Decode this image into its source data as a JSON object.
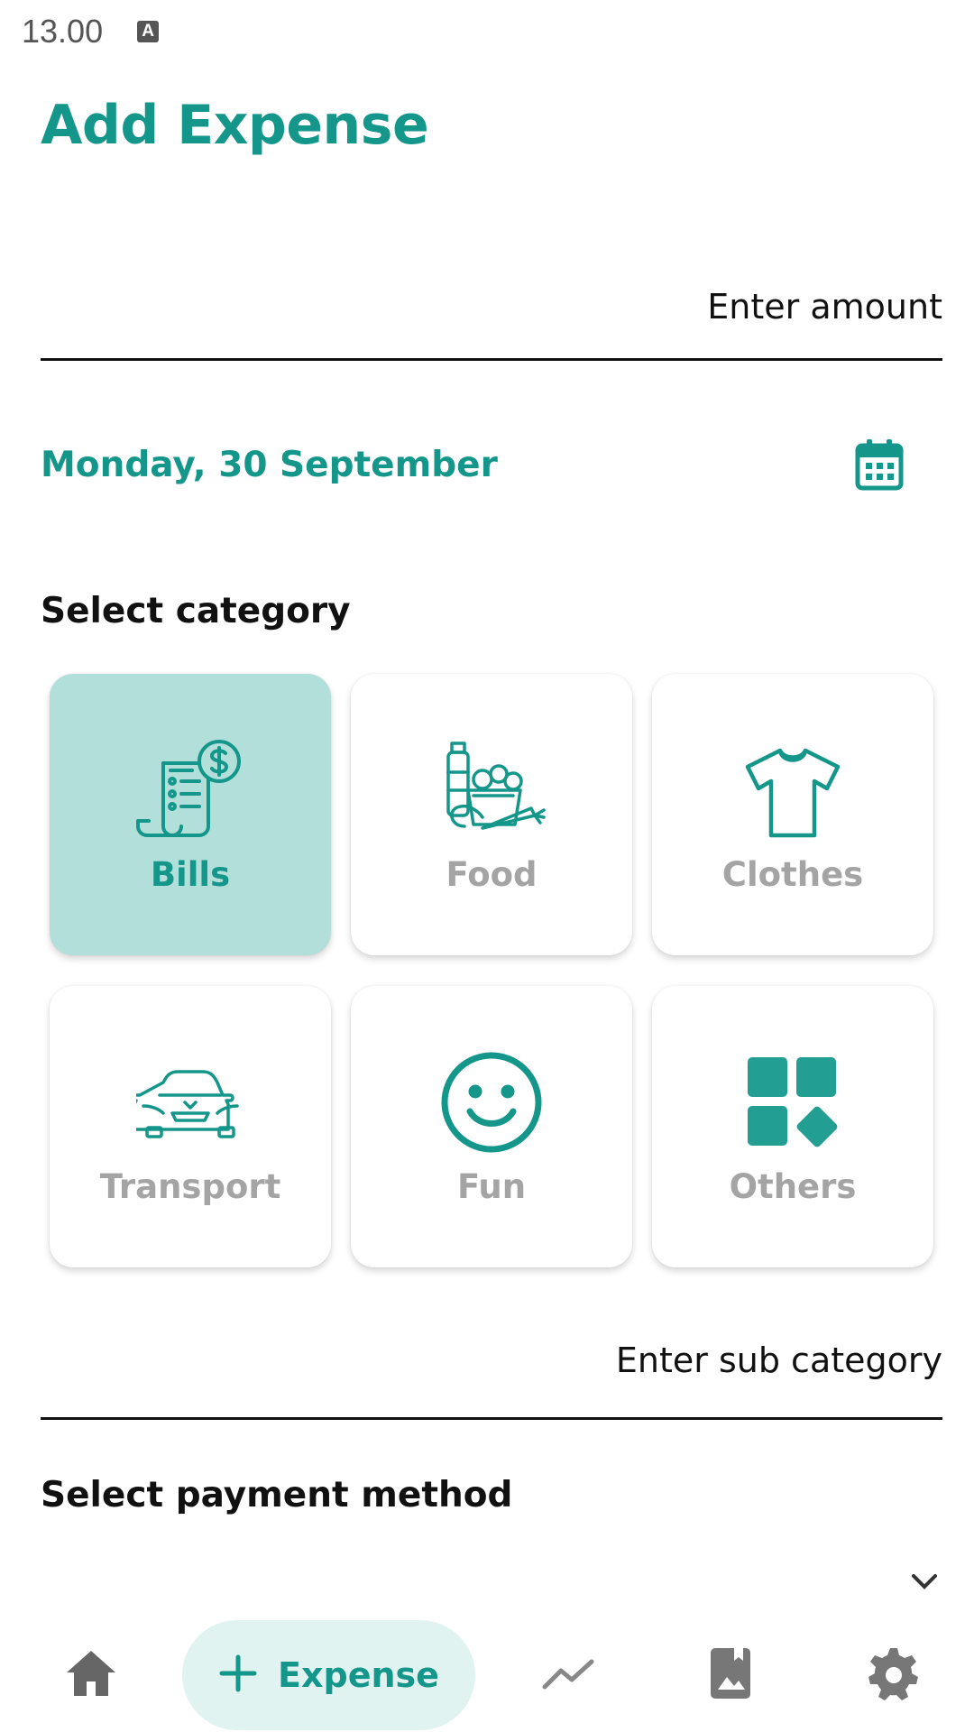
{
  "status_bar": {
    "time": "13.00",
    "indicator": "A"
  },
  "page": {
    "title": "Add Expense"
  },
  "amount": {
    "placeholder": "Enter amount",
    "value": ""
  },
  "date": {
    "label": "Monday, 30 September",
    "icon": "calendar-icon"
  },
  "category": {
    "heading": "Select category",
    "items": [
      {
        "label": "Bills",
        "icon": "bills-receipt-icon",
        "selected": true
      },
      {
        "label": "Food",
        "icon": "groceries-food-icon",
        "selected": false
      },
      {
        "label": "Clothes",
        "icon": "tshirt-icon",
        "selected": false
      },
      {
        "label": "Transport",
        "icon": "car-icon",
        "selected": false
      },
      {
        "label": "Fun",
        "icon": "smiley-face-icon",
        "selected": false
      },
      {
        "label": "Others",
        "icon": "apps-grid-icon",
        "selected": false
      }
    ]
  },
  "sub_category": {
    "placeholder": "Enter sub category",
    "value": ""
  },
  "payment": {
    "heading": "Select payment method",
    "selected_value": ""
  },
  "bottom_nav": {
    "items": [
      {
        "name": "home",
        "icon": "home-icon"
      },
      {
        "name": "expense",
        "label": "Expense",
        "icon": "plus-icon",
        "active": true
      },
      {
        "name": "stats",
        "icon": "trending-icon"
      },
      {
        "name": "gallery",
        "icon": "photo-book-icon"
      },
      {
        "name": "settings",
        "icon": "gear-icon"
      }
    ]
  },
  "colors": {
    "accent": "#14968a",
    "selected_bg": "#b3dfdb",
    "inactive_label": "#a4a4a4",
    "pill_bg": "#e1f3f1"
  }
}
